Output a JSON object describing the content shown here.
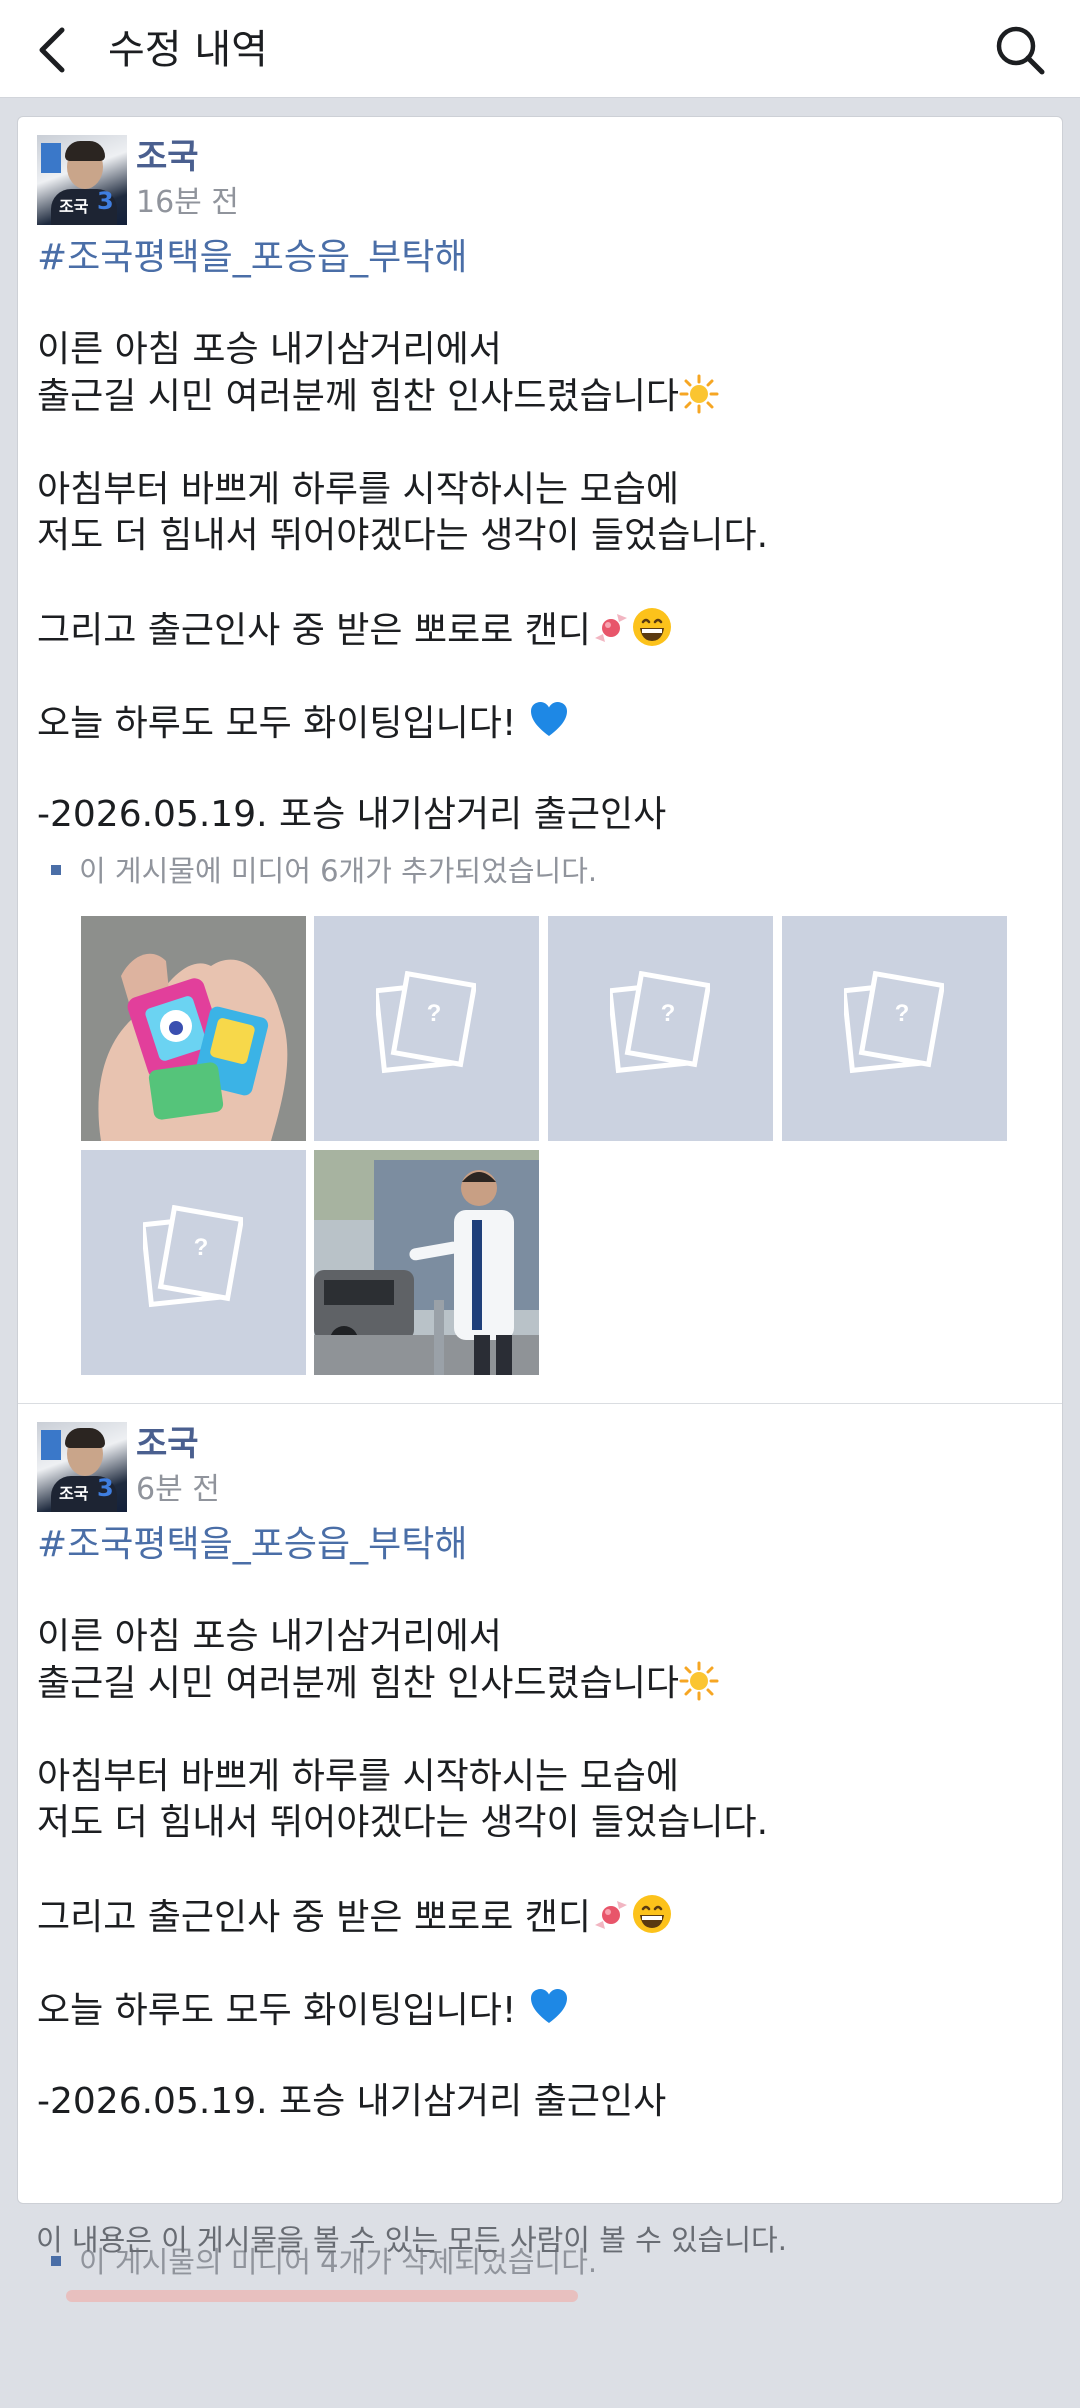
{
  "header": {
    "title": "수정 내역",
    "back_icon": "chevron-left-icon",
    "search_icon": "search-icon"
  },
  "posts": [
    {
      "author": "조국",
      "avatar_label": "조국",
      "avatar_number": "3",
      "time": "16분 전",
      "hashtag": "#조국평택을_포승읍_부탁해",
      "lines": {
        "l1": "이른 아침 포승 내기삼거리에서",
        "l2": "출근길 시민 여러분께 힘찬 인사드렸습니다",
        "l3": "아침부터 바쁘게 하루를 시작하시는 모습에",
        "l4": "저도 더 힘내서 뛰어야겠다는 생각이 들었습니다.",
        "l5": "그리고 출근인사 중 받은 뽀로로 캔디",
        "l6": "오늘 하루도 모두 화이팅입니다! ",
        "l7": "-2026.05.19. 포승 내기삼거리 출근인사"
      },
      "media_note": "이 게시물에 미디어 6개가 추가되었습니다.",
      "media": [
        {
          "type": "photo",
          "desc": "candy-in-hand"
        },
        {
          "type": "placeholder"
        },
        {
          "type": "placeholder"
        },
        {
          "type": "placeholder"
        },
        {
          "type": "placeholder"
        },
        {
          "type": "photo",
          "desc": "greeting-at-roadside"
        }
      ]
    },
    {
      "author": "조국",
      "avatar_label": "조국",
      "avatar_number": "3",
      "time": "6분 전",
      "hashtag": "#조국평택을_포승읍_부탁해",
      "lines": {
        "l1": "이른 아침 포승 내기삼거리에서",
        "l2": "출근길 시민 여러분께 힘찬 인사드렸습니다",
        "l3": "아침부터 바쁘게 하루를 시작하시는 모습에",
        "l4": "저도 더 힘내서 뛰어야겠다는 생각이 들었습니다.",
        "l5": "그리고 출근인사 중 받은 뽀로로 캔디",
        "l6": "오늘 하루도 모두 화이팅입니다! ",
        "l7": "-2026.05.19. 포승 내기삼거리 출근인사"
      },
      "media_note": "이 게시물의 미디어 4개가 삭제되었습니다."
    }
  ],
  "placeholder_mark": "?",
  "footer_text": "이 내용은 이 게시물을 볼 수 있는 모든 사람이 볼 수 있습니다.",
  "colors": {
    "link": "#4a6ea7",
    "author": "#4a5f8f",
    "muted": "#90949c",
    "placeholder_bg": "#cbd2e0",
    "highlight": "#f2a6a0"
  }
}
